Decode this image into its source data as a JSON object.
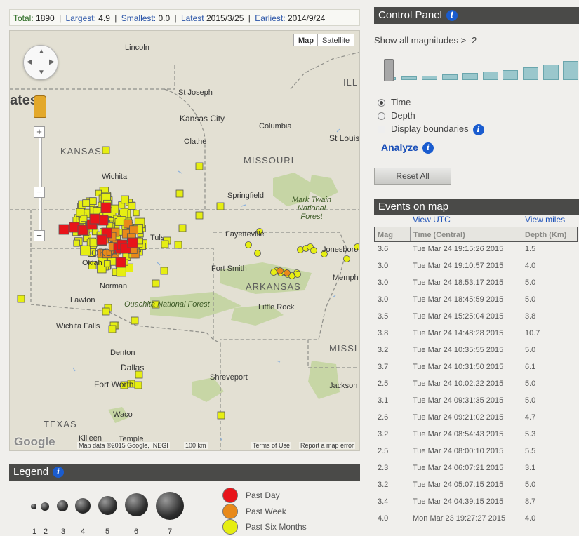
{
  "summary": {
    "total_label": "Total:",
    "total_value": "1890",
    "largest_label": "Largest:",
    "largest_value": "4.9",
    "smallest_label": "Smallest:",
    "smallest_value": "0.0",
    "latest_label": "Latest",
    "latest_value": "2015/3/25",
    "earliest_label": "Earliest:",
    "earliest_value": "2014/9/24",
    "separator": "|"
  },
  "map": {
    "type_buttons": {
      "map": "Map",
      "satellite": "Satellite"
    },
    "zoom_in": "+",
    "zoom_out": "−",
    "labels": {
      "lincoln": "Lincoln",
      "st_joseph": "St Joseph",
      "kansas_city": "Kansas City",
      "olathe": "Olathe",
      "columbia": "Columbia",
      "st_louis": "St Louis",
      "ill": "ILL",
      "ates": "ates",
      "kansas": "KANSAS",
      "missouri": "MISSOURI",
      "wichita": "Wichita",
      "springfield": "Springfield",
      "mark_twain": "Mark Twain National Forest",
      "tulsa": "Tuls",
      "fayetteville": "Fayetteville",
      "jonesboro": "Jonesboro",
      "okla": "OKLA",
      "oklahoma_city": "Oklah",
      "fort_smith": "Fort Smith",
      "memphis": "Memph",
      "arkansas": "ARKANSAS",
      "norman": "Norman",
      "lawton": "Lawton",
      "ouachita": "Ouachita National Forest",
      "little_rock": "Little Rock",
      "wichita_falls": "Wichita Falls",
      "missi": "MISSI",
      "denton": "Denton",
      "dallas": "Dallas",
      "fort_worth": "Fort Worth",
      "shreveport": "Shreveport",
      "jackson": "Jackson",
      "waco": "Waco",
      "texas": "TEXAS",
      "killeen": "Killeen",
      "temple": "Temple"
    },
    "footer": {
      "logo": "Google",
      "data": "Map data ©2015 Google, INEGI",
      "scale": "100 km",
      "terms": "Terms of Use",
      "report": "Report a map error"
    },
    "colors": {
      "past_day": "#e8141a",
      "past_week": "#e8891a",
      "past_six_months": "#e6ee12"
    }
  },
  "legend": {
    "title": "Legend",
    "sizes": [
      "1",
      "2",
      "3",
      "4",
      "5",
      "6",
      "7"
    ],
    "items": [
      {
        "label": "Past Day",
        "color": "#e8141a"
      },
      {
        "label": "Past Week",
        "color": "#e8891a"
      },
      {
        "label": "Past Six Months",
        "color": "#e6ee12"
      }
    ]
  },
  "control_panel": {
    "title": "Control Panel",
    "magnitude_text": "Show all magnitudes > -2",
    "options": {
      "time": "Time",
      "depth": "Depth",
      "boundaries": "Display boundaries"
    },
    "color_by": "time",
    "display_boundaries": false,
    "analyze": "Analyze",
    "reset": "Reset All"
  },
  "events": {
    "title": "Events on map",
    "view_utc": "View UTC",
    "view_miles": "View miles",
    "headers": {
      "mag": "Mag",
      "time": "Time (Central)",
      "depth": "Depth (Km)"
    },
    "rows": [
      {
        "mag": "3.6",
        "time": "Tue Mar 24 19:15:26 2015",
        "depth": "1.5"
      },
      {
        "mag": "3.0",
        "time": "Tue Mar 24 19:10:57 2015",
        "depth": "4.0"
      },
      {
        "mag": "3.0",
        "time": "Tue Mar 24 18:53:17 2015",
        "depth": "5.0"
      },
      {
        "mag": "3.0",
        "time": "Tue Mar 24 18:45:59 2015",
        "depth": "5.0"
      },
      {
        "mag": "3.5",
        "time": "Tue Mar 24 15:25:04 2015",
        "depth": "3.8"
      },
      {
        "mag": "3.8",
        "time": "Tue Mar 24 14:48:28 2015",
        "depth": "10.7"
      },
      {
        "mag": "3.2",
        "time": "Tue Mar 24 10:35:55 2015",
        "depth": "5.0"
      },
      {
        "mag": "3.7",
        "time": "Tue Mar 24 10:31:50 2015",
        "depth": "6.1"
      },
      {
        "mag": "2.5",
        "time": "Tue Mar 24 10:02:22 2015",
        "depth": "5.0"
      },
      {
        "mag": "3.1",
        "time": "Tue Mar 24 09:31:35 2015",
        "depth": "5.0"
      },
      {
        "mag": "2.6",
        "time": "Tue Mar 24 09:21:02 2015",
        "depth": "4.7"
      },
      {
        "mag": "3.2",
        "time": "Tue Mar 24 08:54:43 2015",
        "depth": "5.3"
      },
      {
        "mag": "2.5",
        "time": "Tue Mar 24 08:00:10 2015",
        "depth": "5.5"
      },
      {
        "mag": "2.3",
        "time": "Tue Mar 24 06:07:21 2015",
        "depth": "3.1"
      },
      {
        "mag": "3.2",
        "time": "Tue Mar 24 05:07:15 2015",
        "depth": "5.0"
      },
      {
        "mag": "3.4",
        "time": "Tue Mar 24 04:39:15 2015",
        "depth": "8.7"
      },
      {
        "mag": "4.0",
        "time": "Mon Mar 23 19:27:27 2015",
        "depth": "4.0"
      }
    ]
  }
}
